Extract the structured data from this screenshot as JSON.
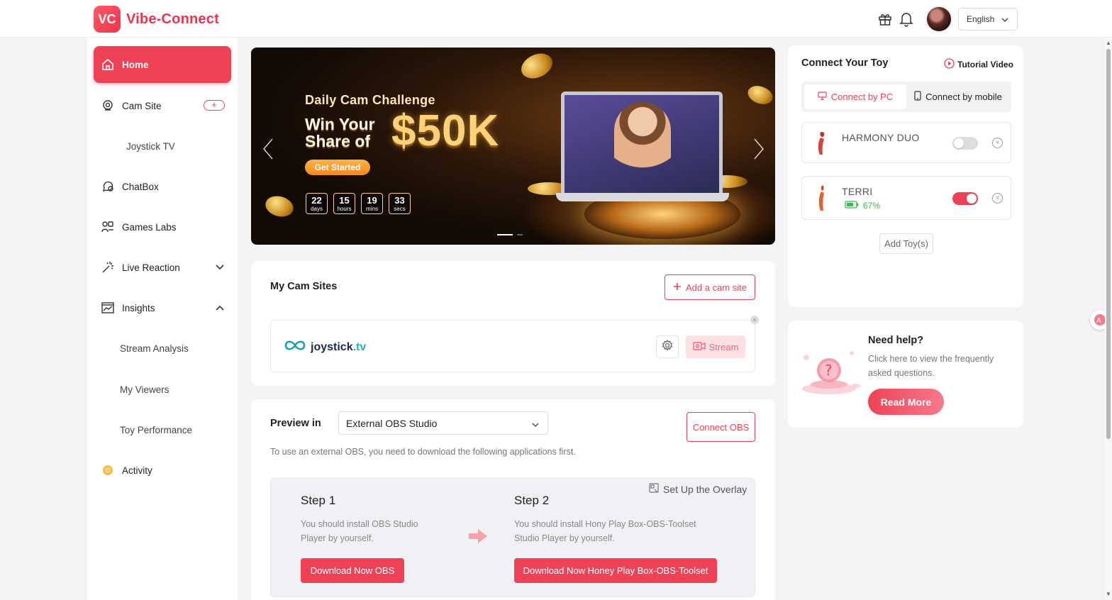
{
  "app": {
    "logo_mark": "VC",
    "name": "Vibe-Connect"
  },
  "header": {
    "language": "English"
  },
  "sidebar": {
    "items": [
      {
        "label": "Home",
        "icon": "home-icon",
        "active": true
      },
      {
        "label": "Cam Site",
        "icon": "target-icon",
        "add": "+"
      },
      {
        "label": "Joystick TV"
      },
      {
        "label": "ChatBox",
        "icon": "chat-icon"
      },
      {
        "label": "Games Labs",
        "icon": "games-icon"
      },
      {
        "label": "Live Reaction",
        "icon": "magic-wand-icon"
      },
      {
        "label": "Insights",
        "icon": "insights-icon"
      },
      {
        "label": "Stream Analysis"
      },
      {
        "label": "My Viewers"
      },
      {
        "label": "Toy Performance"
      },
      {
        "label": "Activity",
        "icon": "activity-coin-icon"
      }
    ]
  },
  "banner": {
    "subtitle": "Daily Cam Challenge",
    "headline_line1": "Win Your",
    "headline_line2": "Share of",
    "amount": "$50K",
    "cta": "Get Started",
    "countdown": [
      {
        "value": "22",
        "unit": "days"
      },
      {
        "value": "15",
        "unit": "hours"
      },
      {
        "value": "19",
        "unit": "mins"
      },
      {
        "value": "33",
        "unit": "secs"
      }
    ]
  },
  "cam_sites": {
    "title": "My Cam Sites",
    "add_label": "Add a cam site",
    "site_name": "joystick",
    "site_tld": ".tv",
    "stream_label": "Stream"
  },
  "obs": {
    "preview_label": "Preview in",
    "selected": "External OBS Studio",
    "connect_label": "Connect OBS",
    "note": "To use an external OBS, you need to download the following applications first.",
    "overlay_link": "Set Up the Overlay",
    "step1": {
      "title": "Step 1",
      "text": "You should install OBS Studio Player by yourself.",
      "button": "Download Now OBS"
    },
    "step2": {
      "title": "Step 2",
      "text": "You should install Hony Play Box-OBS-Toolset Studio Player by yourself.",
      "button": "Download Now Honey Play Box-OBS-Toolset"
    }
  },
  "connect": {
    "title": "Connect Your Toy",
    "tutorial": "Tutorial Video",
    "tab_pc": "Connect by PC",
    "tab_mobile": "Connect by mobile",
    "toys": [
      {
        "name": "HARMONY DUO",
        "enabled": false
      },
      {
        "name": "TERRI",
        "enabled": true,
        "battery": "67%"
      }
    ],
    "add_toy": "Add Toy(s)"
  },
  "help": {
    "title": "Need help?",
    "text": "Click here to view the frequently asked questions.",
    "button": "Read More"
  },
  "colors": {
    "accent": "#ef4257",
    "battery": "#3cb950"
  }
}
